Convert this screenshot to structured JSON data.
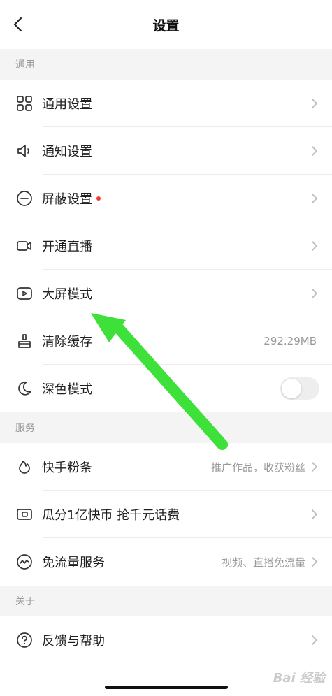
{
  "header": {
    "title": "设置"
  },
  "sections": {
    "general": "通用",
    "service": "服务",
    "about": "关于"
  },
  "items": {
    "general_settings": {
      "label": "通用设置"
    },
    "notify_settings": {
      "label": "通知设置"
    },
    "block_settings": {
      "label": "屏蔽设置"
    },
    "live": {
      "label": "开通直播"
    },
    "bigscreen": {
      "label": "大屏模式"
    },
    "cache": {
      "label": "清除缓存",
      "value": "292.29MB"
    },
    "dark": {
      "label": "深色模式"
    },
    "fans": {
      "label": "快手粉条",
      "hint": "推广作品，收获粉丝"
    },
    "coins": {
      "label": "瓜分1亿快币 抢千元话费"
    },
    "dataflow": {
      "label": "免流量服务",
      "hint": "视频、直播免流量"
    },
    "feedback": {
      "label": "反馈与帮助"
    }
  },
  "toggle": {
    "dark_mode_on": false
  },
  "watermark": "Bai 经验",
  "colors": {
    "arrow": "#3ee03a",
    "badge": "#f03a3a",
    "section_bg": "#f4f4f4"
  }
}
